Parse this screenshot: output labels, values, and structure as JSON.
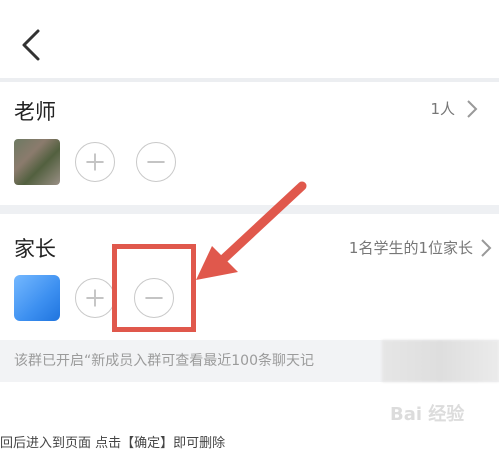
{
  "teachers": {
    "title": "老师",
    "count_label": "1人"
  },
  "parents": {
    "title": "家长",
    "count_label": "1名学生的1位家长"
  },
  "notice": "该群已开启“新成员入群可查看最近100条聊天记",
  "watermark": "Bai 经验",
  "bottom_caption": "回后进入到页面 点击【确定】即可删除",
  "icons": [
    "back-icon",
    "chevron-right-icon",
    "plus-icon",
    "minus-icon"
  ],
  "colors": {
    "highlight": "#e0584c",
    "arrow": "#e0584c"
  }
}
